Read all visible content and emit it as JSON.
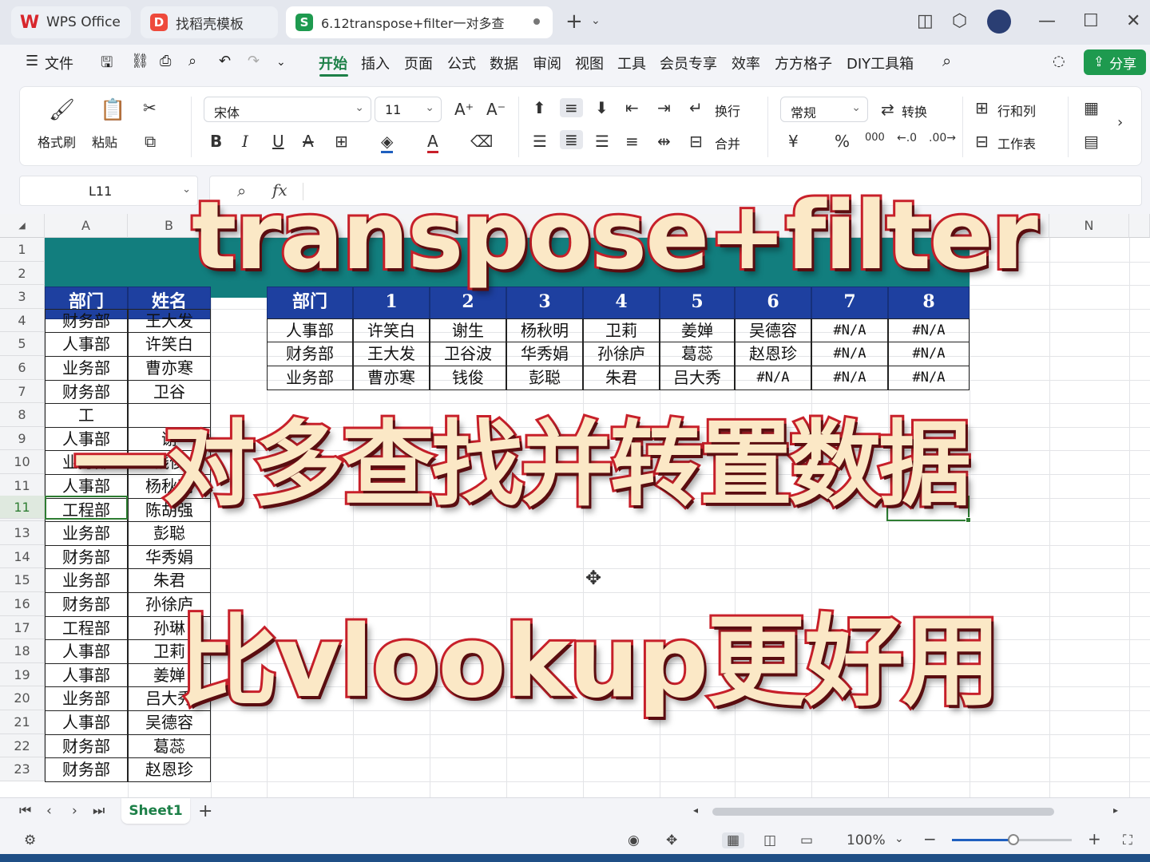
{
  "window": {
    "tabs": [
      {
        "label": "WPS Office",
        "icon": "wps-logo-icon"
      },
      {
        "label": "找稻壳模板",
        "icon": "docer-icon"
      },
      {
        "label": "6.12transpose+filter一对多查",
        "icon": "spreadsheet-icon"
      }
    ],
    "add_tab": "+"
  },
  "menu": {
    "file": "文件",
    "items": [
      "开始",
      "插入",
      "页面",
      "公式",
      "数据",
      "审阅",
      "视图",
      "工具",
      "会员专享",
      "效率",
      "方方格子",
      "DIY工具箱"
    ],
    "active": "开始",
    "share": "分享"
  },
  "ribbon": {
    "format_painter": "格式刷",
    "paste": "粘贴",
    "font_name": "宋体",
    "font_size": "11",
    "wrap": "换行",
    "merge": "合并",
    "number_format": "常规",
    "convert": "转换",
    "rows_cols": "行和列",
    "worksheet": "工作表",
    "bold": "B",
    "italic": "I",
    "underline": "U",
    "currency": "¥",
    "percent": "%",
    "thousands": "000"
  },
  "formula_bar": {
    "name_box": "L11",
    "fx": "fx"
  },
  "columns": [
    "A",
    "B",
    "M",
    "N"
  ],
  "rows": [
    "1",
    "2",
    "3",
    "4",
    "5",
    "6",
    "7",
    "8",
    "9",
    "10",
    "11",
    "12",
    "13",
    "14",
    "15",
    "16",
    "17",
    "18",
    "19",
    "20",
    "21",
    "22",
    "23"
  ],
  "source_table": {
    "headers": [
      "部门",
      "姓名"
    ],
    "rows": [
      [
        "财务部",
        "王大发"
      ],
      [
        "人事部",
        "许笑白"
      ],
      [
        "业务部",
        "曹亦寒"
      ],
      [
        "财务部",
        "卫谷"
      ],
      [
        "工",
        ""
      ],
      [
        "人事部",
        "谢"
      ],
      [
        "业务部",
        "钱俊"
      ],
      [
        "人事部",
        "杨秋明"
      ],
      [
        "工程部",
        "陈胡强"
      ],
      [
        "业务部",
        "彭聪"
      ],
      [
        "财务部",
        "华秀娟"
      ],
      [
        "业务部",
        "朱君"
      ],
      [
        "财务部",
        "孙徐庐"
      ],
      [
        "工程部",
        "孙琳"
      ],
      [
        "人事部",
        "卫莉"
      ],
      [
        "人事部",
        "姜婵"
      ],
      [
        "业务部",
        "吕大秀"
      ],
      [
        "人事部",
        "吴德容"
      ],
      [
        "财务部",
        "葛蕊"
      ],
      [
        "财务部",
        "赵恩珍"
      ]
    ]
  },
  "result_table": {
    "headers": [
      "部门",
      "1",
      "2",
      "3",
      "4",
      "5",
      "6",
      "7",
      "8"
    ],
    "rows": [
      [
        "人事部",
        "许笑白",
        "谢生",
        "杨秋明",
        "卫莉",
        "姜婵",
        "吴德容",
        "#N/A",
        "#N/A"
      ],
      [
        "财务部",
        "王大发",
        "卫谷波",
        "华秀娟",
        "孙徐庐",
        "葛蕊",
        "赵恩珍",
        "#N/A",
        "#N/A"
      ],
      [
        "业务部",
        "曹亦寒",
        "钱俊",
        "彭聪",
        "朱君",
        "吕大秀",
        "#N/A",
        "#N/A",
        "#N/A"
      ]
    ]
  },
  "overlay": {
    "line1": "transpose+filter",
    "line2": "一对多查找并转置数据",
    "line3": "比vlookup更好用"
  },
  "sheet_tabs": {
    "active": "Sheet1",
    "add": "+"
  },
  "status": {
    "zoom": "100%",
    "zoom_level": 0.5
  },
  "colors": {
    "accent": "#1e9a4f",
    "header_blue": "#1e40a0",
    "title_band": "#127e7e",
    "overlay_fill": "#fbe8c6",
    "overlay_stroke": "#c8202a"
  }
}
